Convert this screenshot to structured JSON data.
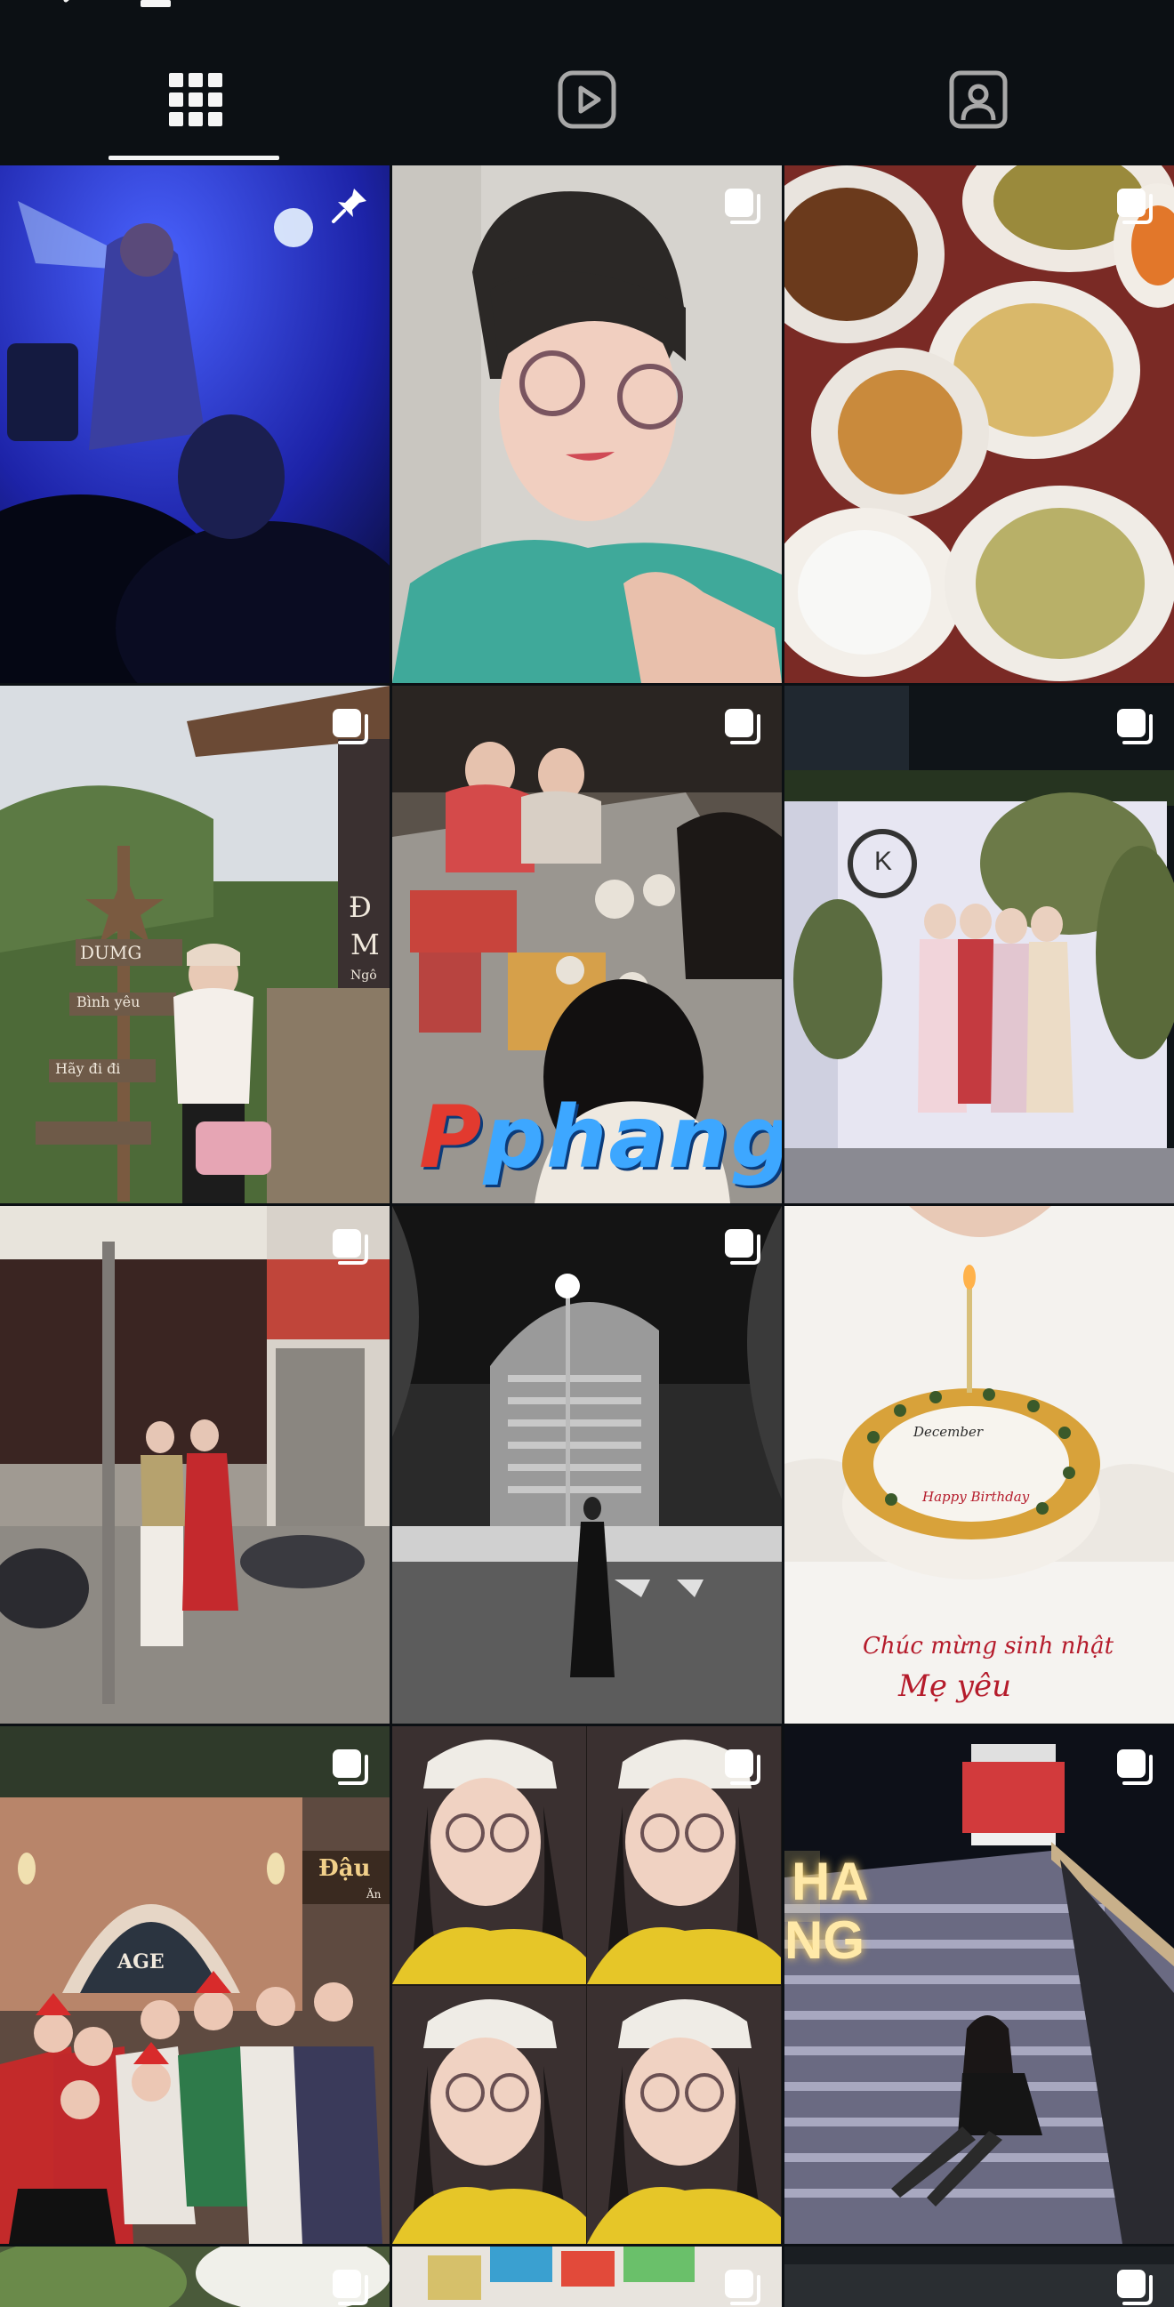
{
  "header": {
    "back_icon": "chevron-left-icon",
    "menu_icon": "menu-icon",
    "settings_icon": "settings-icon"
  },
  "tabs": [
    {
      "icon": "grid-icon",
      "selected": true
    },
    {
      "icon": "reels-icon",
      "selected": false
    },
    {
      "icon": "tagged-icon",
      "selected": false
    }
  ],
  "posts": [
    {
      "subject": "concert stage with blue lights",
      "badge": "pin-icon"
    },
    {
      "subject": "selfie with glasses",
      "badge": "multi-photo-icon"
    },
    {
      "subject": "food on plates",
      "badge": "multi-photo-icon"
    },
    {
      "subject": "woman by wooden sign post",
      "badge": "multi-photo-icon",
      "sign_lines": [
        "DUMG",
        "Bình yêu",
        "Hãy đi đi"
      ],
      "side_text": [
        "Đ",
        "M",
        "Ngô"
      ]
    },
    {
      "subject": "friends at hotpot restaurant",
      "badge": "multi-photo-icon",
      "watermark_red": "P",
      "watermark_blue": "phang"
    },
    {
      "subject": "group in ao dai at flower backdrop",
      "badge": "multi-photo-icon",
      "logo": "K"
    },
    {
      "subject": "two women on street",
      "badge": "multi-photo-icon"
    },
    {
      "subject": "black and white night street",
      "badge": "multi-photo-icon"
    },
    {
      "subject": "birthday cake with candle",
      "badge": "multi-photo-icon",
      "cake_top": "December",
      "cake_mid": "Happy Birthday",
      "cake_line1": "Chúc mừng sinh nhật",
      "cake_line2": "Mẹ yêu"
    },
    {
      "subject": "christmas group photo",
      "badge": "multi-photo-icon",
      "shop_sign": [
        "Đậu",
        "Ăn"
      ],
      "arch": "AGE"
    },
    {
      "subject": "four-panel selfie collage",
      "badge": "multi-photo-icon"
    },
    {
      "subject": "woman on steps by lighthouse",
      "badge": "multi-photo-icon",
      "neon": [
        "HA",
        "NG"
      ]
    },
    {
      "subject": "partial row",
      "badge": "multi-photo-icon"
    },
    {
      "subject": "partial row",
      "badge": "multi-photo-icon"
    },
    {
      "subject": "partial row",
      "badge": "multi-photo-icon"
    }
  ]
}
